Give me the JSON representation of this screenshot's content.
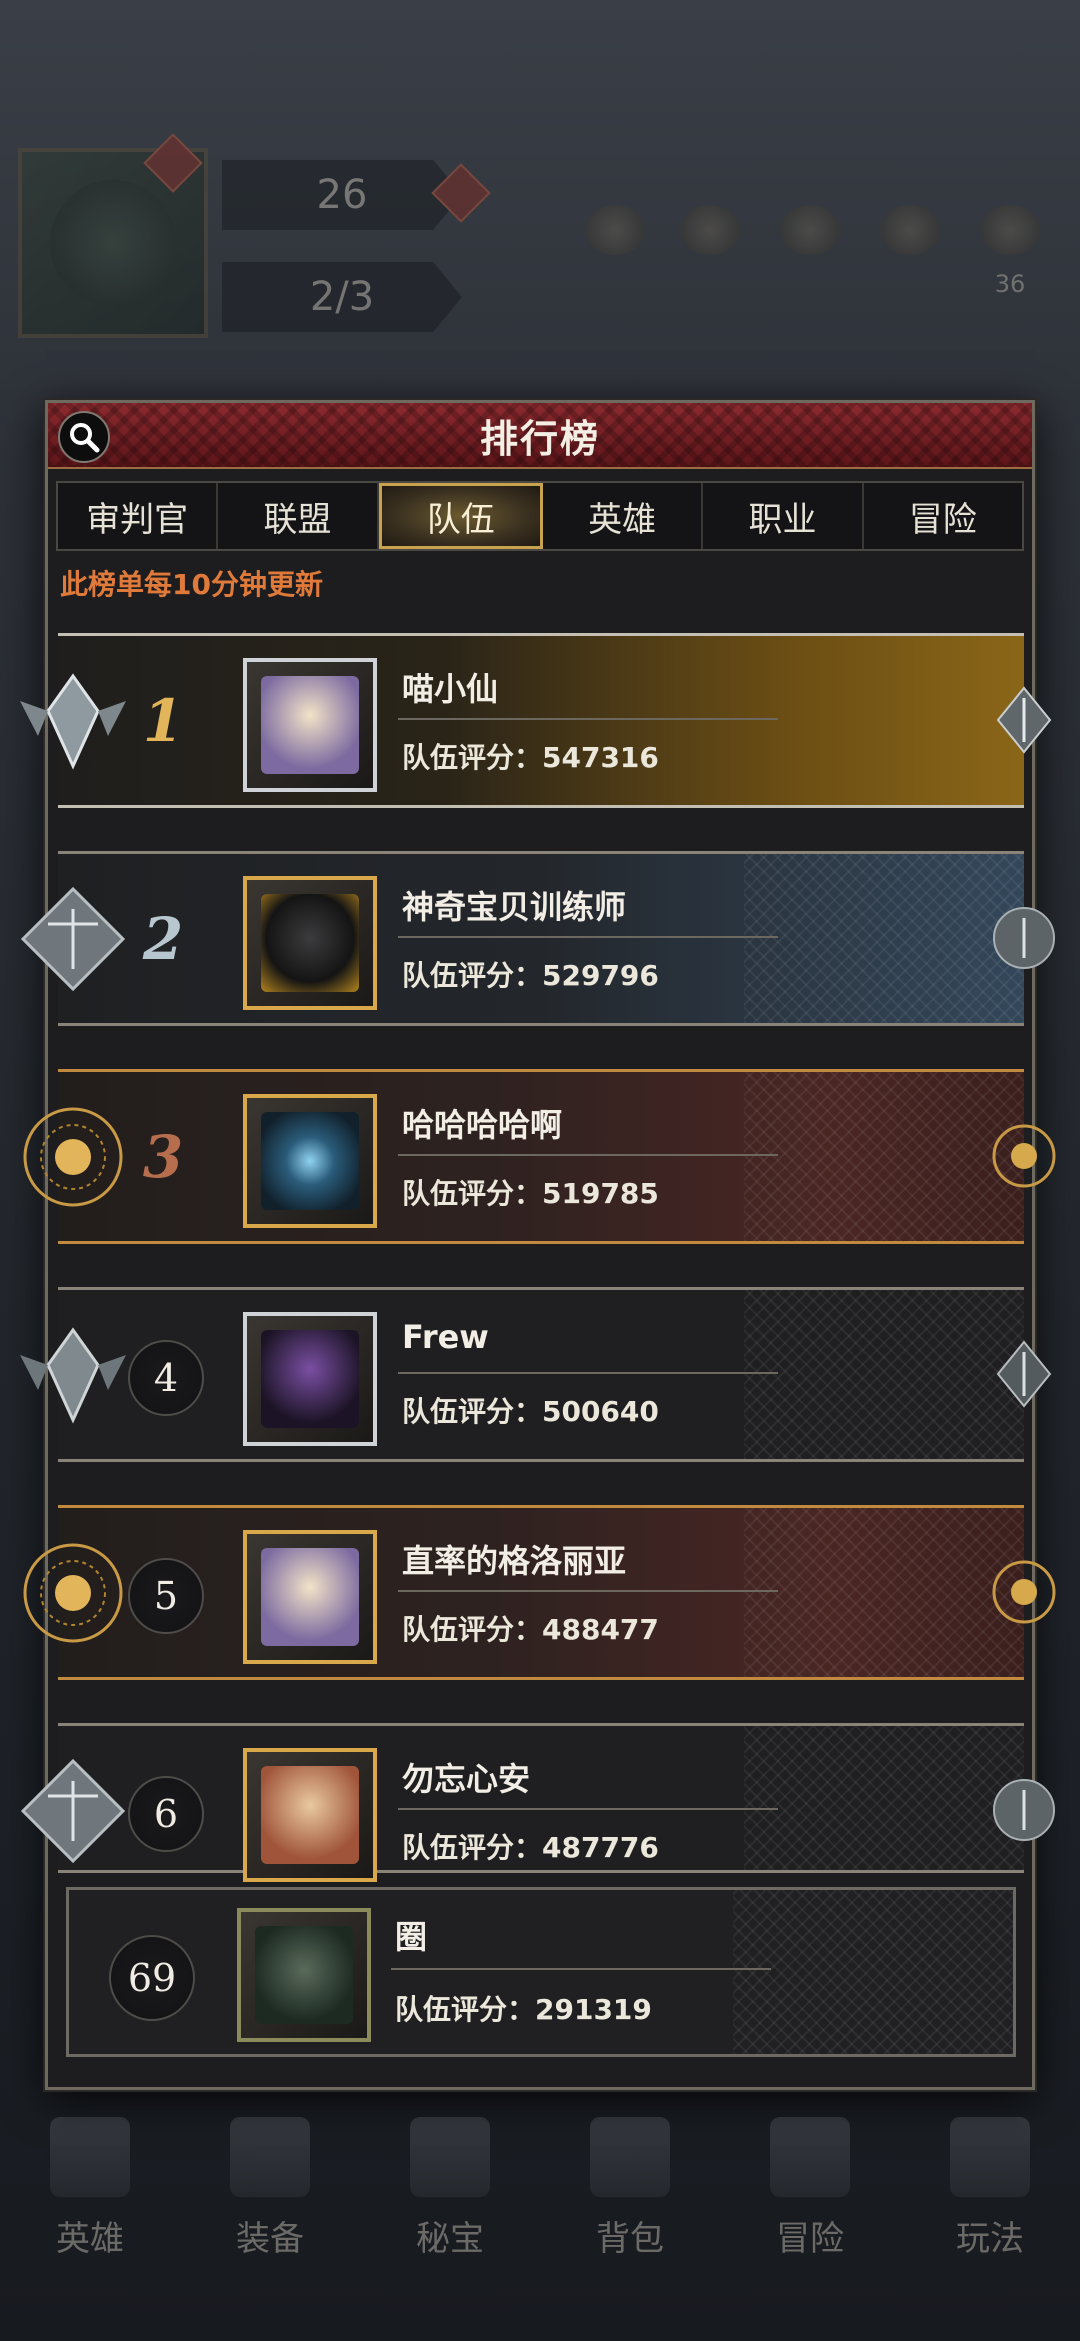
{
  "hud": {
    "level": "26",
    "stamina": "2/3",
    "resources": [
      "",
      "",
      "",
      "",
      "36"
    ]
  },
  "modal": {
    "title": "排行榜",
    "note": "此榜单每10分钟更新",
    "tabs": [
      {
        "label": "审判官",
        "active": false
      },
      {
        "label": "联盟",
        "active": false
      },
      {
        "label": "队伍",
        "active": true
      },
      {
        "label": "英雄",
        "active": false
      },
      {
        "label": "职业",
        "active": false
      },
      {
        "label": "冒险",
        "active": false
      }
    ]
  },
  "rankings": [
    {
      "rank": "1",
      "name": "喵小仙",
      "score": "队伍评分：547316"
    },
    {
      "rank": "2",
      "name": "神奇宝贝训练师",
      "score": "队伍评分：529796"
    },
    {
      "rank": "3",
      "name": "哈哈哈哈啊",
      "score": "队伍评分：519785"
    },
    {
      "rank": "4",
      "name": "Frew",
      "score": "队伍评分：500640"
    },
    {
      "rank": "5",
      "name": "直率的格洛丽亚",
      "score": "队伍评分：488477"
    },
    {
      "rank": "6",
      "name": "勿忘心安",
      "score": "队伍评分：487776"
    }
  ],
  "my_rank": {
    "rank": "69",
    "name": "圈",
    "score": "队伍评分：291319"
  },
  "bottom_nav": [
    "英雄",
    "装备",
    "秘宝",
    "背包",
    "冒险",
    "玩法"
  ],
  "colors": {
    "header_red": "#8c2a2f",
    "note_orange": "#e07a3a",
    "gold": "#e2b55a",
    "silver": "#b8c7cf",
    "bronze": "#b66e4f"
  }
}
